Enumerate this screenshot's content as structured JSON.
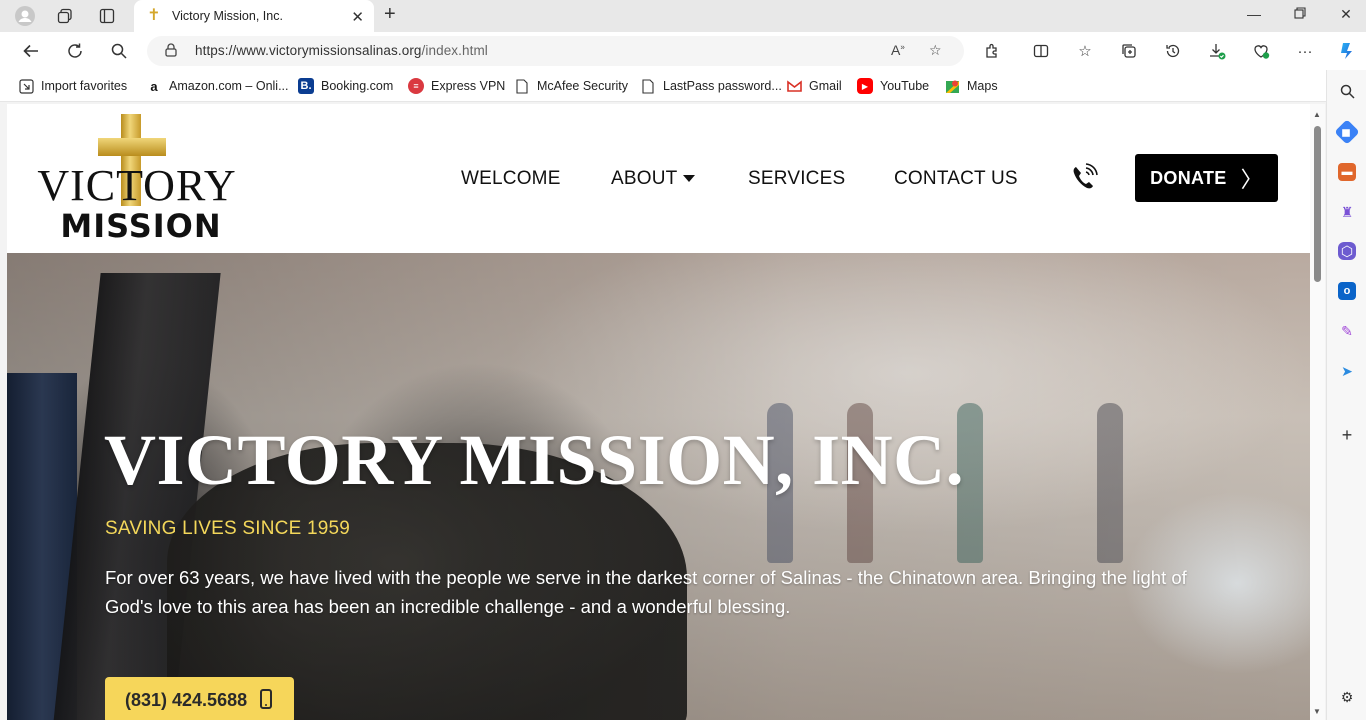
{
  "browser": {
    "tab_title": "Victory Mission, Inc.",
    "url_host": "https://www.victorymissionsalinas.org",
    "url_path": "/index.html",
    "favorites": [
      {
        "label": "Import favorites",
        "icon": "import-icon"
      },
      {
        "label": "Amazon.com – Onli...",
        "icon": "amazon-icon"
      },
      {
        "label": "Booking.com",
        "icon": "booking-icon"
      },
      {
        "label": "Express VPN",
        "icon": "expressvpn-icon"
      },
      {
        "label": "McAfee Security",
        "icon": "page-icon"
      },
      {
        "label": "LastPass password...",
        "icon": "page-icon"
      },
      {
        "label": "Gmail",
        "icon": "gmail-icon"
      },
      {
        "label": "YouTube",
        "icon": "youtube-icon"
      },
      {
        "label": "Maps",
        "icon": "maps-icon"
      }
    ]
  },
  "site": {
    "logo_top": "VICTORY",
    "logo_bottom": "MISSION",
    "nav": {
      "welcome": "WELCOME",
      "about": "ABOUT",
      "services": "SERVICES",
      "contact": "CONTACT US"
    },
    "donate_label": "DONATE"
  },
  "hero": {
    "title": "VICTORY MISSION, INC.",
    "subtitle": "SAVING LIVES SINCE 1959",
    "body": "For over 63 years, we have lived with the people we serve in the darkest corner of Salinas - the Chinatown area. Bringing the light of God's love to this area has been an incredible challenge - and a wonderful blessing.",
    "phone": "(831) 424.5688"
  },
  "colors": {
    "accent_yellow": "#f6d65a",
    "subtitle_yellow": "#f3d75a",
    "gold": "#d4a72c",
    "donate_bg": "#000000"
  }
}
